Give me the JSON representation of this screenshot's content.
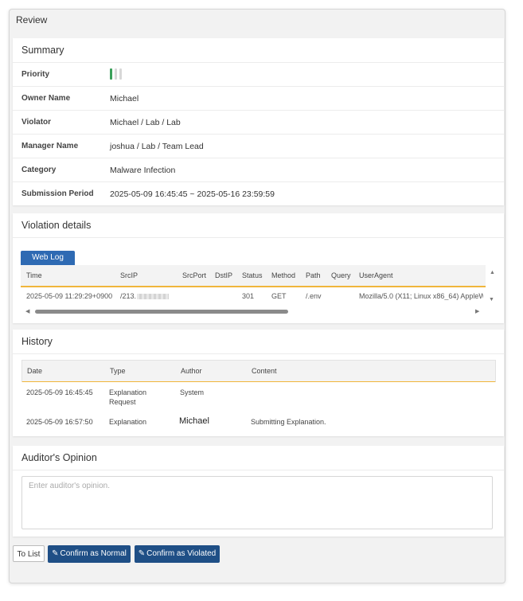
{
  "page": {
    "title": "Review"
  },
  "summary": {
    "title": "Summary",
    "priority_label": "Priority",
    "priority_level": 1,
    "priority_max": 3,
    "priority_color": "#3aa05a",
    "rows": [
      {
        "label": "Owner Name",
        "value": "Michael"
      },
      {
        "label": "Violator",
        "value": "Michael / Lab / Lab"
      },
      {
        "label": "Manager Name",
        "value": "joshua / Lab / Team Lead"
      },
      {
        "label": "Category",
        "value": "Malware Infection"
      },
      {
        "label": "Submission Period",
        "value": "2025-05-09 16:45:45 ~ 2025-05-16 23:59:59"
      }
    ]
  },
  "violation": {
    "title": "Violation details",
    "tab_label": "Web Log",
    "columns": [
      "Time",
      "SrcIP",
      "SrcPort",
      "DstIP",
      "Status",
      "Method",
      "Path",
      "Query",
      "UserAgent"
    ],
    "row": {
      "time": "2025-05-09 11:29:29+0900",
      "srcip": "/213.",
      "srcport": "",
      "dstip": "",
      "status": "301",
      "method": "GET",
      "path": "/.env",
      "query": "",
      "useragent": "Mozilla/5.0 (X11; Linux x86_64) AppleW"
    }
  },
  "history": {
    "title": "History",
    "columns": [
      "Date",
      "Type",
      "Author",
      "Content"
    ],
    "rows": [
      {
        "date": "2025-05-09 16:45:45",
        "type_line1": "Explanation",
        "type_line2": "Request",
        "author": "System",
        "content": ""
      },
      {
        "date": "2025-05-09 16:57:50",
        "type_line1": "Explanation",
        "type_line2": "",
        "author": "Michael",
        "content": "Submitting Explanation."
      }
    ]
  },
  "auditor": {
    "title": "Auditor's Opinion",
    "placeholder": "Enter auditor's opinion.",
    "value": ""
  },
  "actions": {
    "to_list": "To List",
    "confirm_normal": "Confirm as Normal",
    "confirm_violated": "Confirm as Violated"
  },
  "colors": {
    "primary_button": "#1f4f86",
    "tab": "#2e6ab3",
    "header_underline": "#f0b63b"
  },
  "icons": {
    "edit": "pencil-icon",
    "scroll_left": "arrow-left-icon",
    "scroll_right": "arrow-right-icon",
    "scroll_up": "arrow-up-icon",
    "scroll_down": "arrow-down-icon"
  }
}
